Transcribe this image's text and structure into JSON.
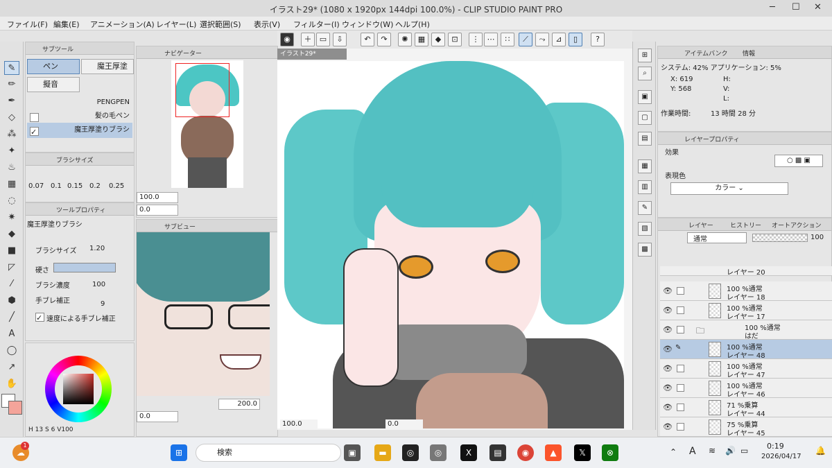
{
  "app": {
    "title": "イラスト29* (1080 x 1920px 144dpi 100.0%) - CLIP STUDIO PAINT PRO"
  },
  "menu": [
    "ファイル(F)",
    "編集(E)",
    "アニメーション(A)",
    "レイヤー(L)",
    "選択範囲(S)",
    "表示(V)",
    "フィルター(I)",
    "ウィンドウ(W)",
    "ヘルプ(H)"
  ],
  "subtool": {
    "tab": "サブツール",
    "items": [
      "ペン",
      "魔王厚塗",
      "擬音"
    ],
    "brushes": [
      "PENGPEN",
      "髪の毛ペン",
      "魔王厚塗りブラシ"
    ]
  },
  "brush_size": {
    "tab": "ブラシサイズ",
    "values": [
      "0.07",
      "0.1",
      "0.15",
      "0.2",
      "0.25"
    ]
  },
  "tool_property": {
    "tab": "ツールプロパティ",
    "brush_name": "魔王厚塗りブラシ",
    "size_label": "ブラシサイズ",
    "size_value": "1.20",
    "hardness_label": "硬さ",
    "density_label": "ブラシ濃度",
    "density_value": "100",
    "stab_label": "手ブレ補正",
    "stab_value": "9",
    "speed_label": "速度による手ブレ補正"
  },
  "color": {
    "main": "#ffffff",
    "sub": "#f4a49a",
    "status": [
      "H",
      "13",
      "S",
      "6",
      "V",
      "100"
    ]
  },
  "navigator": {
    "tab": "ナビゲーター",
    "zoom": "100.0",
    "angle": "0.0"
  },
  "subview": {
    "tab": "サブビュー",
    "zoom": "200.0",
    "angle": "0.0"
  },
  "canvas": {
    "tab": "イラスト29*",
    "zoom": "100.0",
    "angle": "0.0"
  },
  "info": {
    "tab1": "アイテムバンク",
    "tab2": "情報",
    "system": "システム: 42% アプリケーション: 5%",
    "x": "X: 619",
    "y": "Y: 568",
    "h": "H:",
    "w": "W:",
    "v": "V:",
    "l": "L:",
    "worktime_label": "作業時間:",
    "worktime": "13 時間 28 分"
  },
  "layer_property": {
    "tab": "レイヤープロパティ",
    "effect": "効果",
    "exp_color": "表現色",
    "color_mode": "カラー"
  },
  "layers": {
    "tab": "レイヤー",
    "tab2": "ヒストリー",
    "tab3": "オートアクション",
    "blend": "通常",
    "opacity": "100",
    "rows": [
      {
        "l1": "レイヤー 20",
        "l2": ""
      },
      {
        "l1": "100 %通常",
        "l2": "レイヤー 18"
      },
      {
        "l1": "100 %通常",
        "l2": "レイヤー 17"
      },
      {
        "l1": "100 %通常",
        "l2": "はだ"
      },
      {
        "l1": "100 %通常",
        "l2": "レイヤー 48"
      },
      {
        "l1": "100 %通常",
        "l2": "レイヤー 47"
      },
      {
        "l1": "100 %通常",
        "l2": "レイヤー 46"
      },
      {
        "l1": "71 %乗算",
        "l2": "レイヤー 44"
      },
      {
        "l1": "75 %乗算",
        "l2": "レイヤー 45"
      }
    ]
  },
  "taskbar": {
    "search": "検索",
    "time": "0:19",
    "date": "2026/04/17",
    "ime": "A",
    "badge": "1"
  }
}
